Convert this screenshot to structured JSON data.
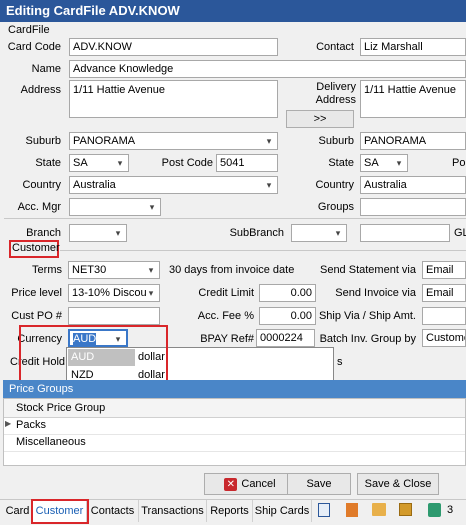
{
  "window_title": "Editing CardFile ADV.KNOW",
  "section_cardfile": "CardFile",
  "card_code": {
    "label": "Card Code",
    "value": "ADV.KNOW"
  },
  "contact": {
    "label": "Contact",
    "value": "Liz Marshall"
  },
  "name": {
    "label": "Name",
    "value": "Advance Knowledge"
  },
  "address": {
    "label": "Address",
    "value": "1/11 Hattie Avenue"
  },
  "delivery_address": {
    "label1": "Delivery",
    "label2": "Address",
    "value": "1/11 Hattie Avenue"
  },
  "copy_button": ">>",
  "suburb": {
    "label": "Suburb",
    "value": "PANORAMA"
  },
  "suburb2": {
    "label": "Suburb",
    "value": "PANORAMA"
  },
  "state": {
    "label": "State",
    "value": "SA"
  },
  "state2": {
    "label": "State",
    "value": "SA"
  },
  "post_code": {
    "label": "Post Code",
    "value": "5041"
  },
  "post_code2": {
    "label": "Po"
  },
  "country": {
    "label": "Country",
    "value": "Australia"
  },
  "country2": {
    "label": "Country",
    "value": "Australia"
  },
  "acc_mgr": {
    "label": "Acc. Mgr",
    "value": ""
  },
  "groups": {
    "label": "Groups",
    "value": ""
  },
  "branch": {
    "label": "Branch",
    "value": ""
  },
  "subbranch": {
    "label": "SubBranch",
    "value": ""
  },
  "gl": {
    "label": "GL"
  },
  "section_customer": "Customer",
  "terms": {
    "label": "Terms",
    "value": "NET30",
    "description": "30 days from invoice date"
  },
  "send_statement": {
    "label": "Send Statement via",
    "value": "Email"
  },
  "price_level": {
    "label": "Price level",
    "value": "13-10% Discou"
  },
  "credit_limit": {
    "label": "Credit Limit",
    "value": "0.00"
  },
  "send_invoice": {
    "label": "Send Invoice via",
    "value": "Email"
  },
  "cust_po": {
    "label": "Cust PO #",
    "value": ""
  },
  "acc_fee": {
    "label": "Acc. Fee %",
    "value": "0.00"
  },
  "ship_via": {
    "label": "Ship Via / Ship Amt."
  },
  "currency": {
    "label": "Currency",
    "value": "AUD"
  },
  "bpay": {
    "label": "BPAY Ref#",
    "value": "0000224"
  },
  "batch_inv": {
    "label": "Batch Inv. Group by",
    "value": "Custome"
  },
  "credit_hold": {
    "label": "Credit Hold"
  },
  "partial_s": "s",
  "currency_options": [
    {
      "code": "AUD",
      "name": "dollar"
    },
    {
      "code": "NZD",
      "name": "dollar"
    }
  ],
  "price_groups": {
    "title": "Price Groups",
    "column": "Stock Price Group",
    "rows": [
      "Packs",
      "Miscellaneous"
    ]
  },
  "buttons": {
    "cancel": "Cancel",
    "save": "Save",
    "save_close": "Save & Close"
  },
  "tabs": [
    "Card",
    "Customer",
    "Contacts",
    "Transactions",
    "Reports",
    "Ship Cards"
  ],
  "tab_badge": "3",
  "colors": {
    "title_bar": "#2b579a",
    "section_header": "#4a86c8",
    "highlight_box": "#d9262a",
    "link_blue": "#1a5fb4",
    "cancel_icon": "#c8282d"
  }
}
